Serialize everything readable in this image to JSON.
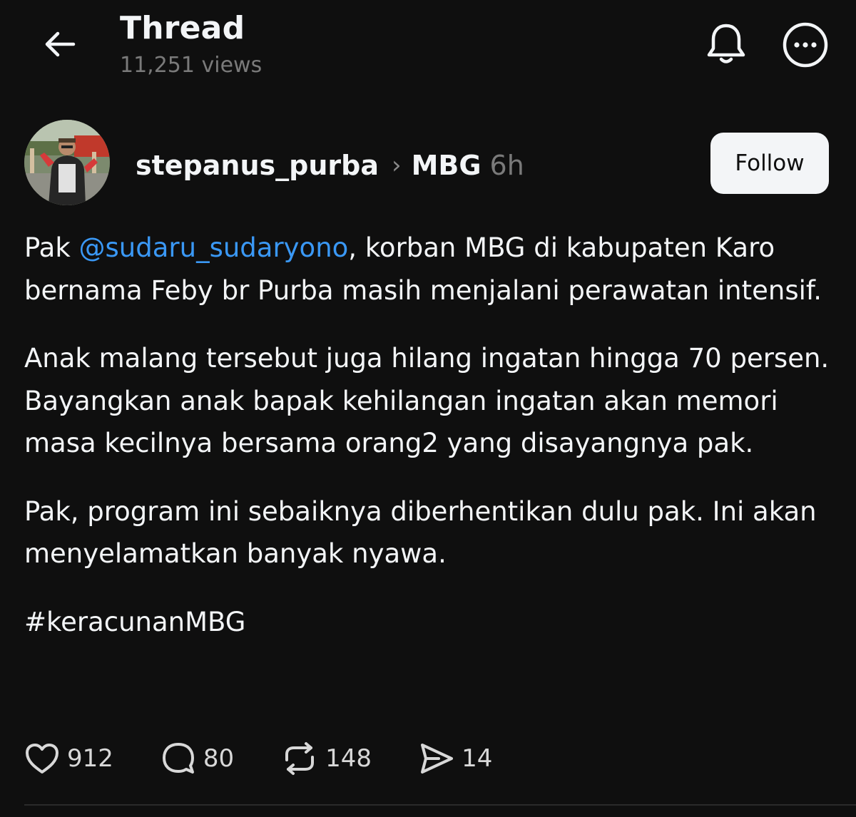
{
  "header": {
    "title": "Thread",
    "views": "11,251 views"
  },
  "post": {
    "author": "stepanus_purba",
    "topic": "MBG",
    "time": "6h",
    "follow_label": "Follow",
    "paragraph1": {
      "prefix": "Pak ",
      "mention": "@sudaru_sudaryono",
      "suffix": ", korban MBG di kabupaten Karo bernama Feby br Purba masih menjalani perawatan intensif."
    },
    "paragraph2": "Anak malang tersebut juga hilang ingatan hingga 70 persen. Bayangkan anak bapak kehilangan ingatan akan memori masa kecilnya bersama orang2 yang disayangnya pak.",
    "paragraph3": "Pak, program ini sebaiknya diberhentikan dulu pak. Ini akan menyelamatkan banyak nyawa.",
    "hashtag": "#keracunanMBG"
  },
  "actions": {
    "likes": "912",
    "replies": "80",
    "reposts": "148",
    "shares": "14"
  },
  "icons": {
    "back": "arrow-left-icon",
    "bell": "bell-icon",
    "more": "more-horizontal-icon",
    "like": "heart-icon",
    "reply": "comment-bubble-icon",
    "repost": "repost-icon",
    "share": "send-icon"
  },
  "colors": {
    "background": "#0f0f0f",
    "text": "#f3f5f7",
    "muted": "#7a7a7a",
    "mention": "#3a98f5"
  }
}
